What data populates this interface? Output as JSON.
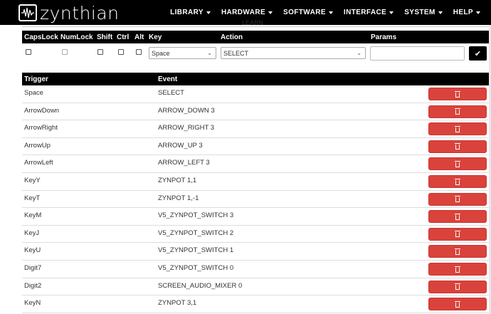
{
  "brand": {
    "name": "zynthian"
  },
  "nav": [
    {
      "label": "LIBRARY"
    },
    {
      "label": "HARDWARE"
    },
    {
      "label": "SOFTWARE"
    },
    {
      "label": "INTERFACE"
    },
    {
      "label": "SYSTEM"
    },
    {
      "label": "HELP"
    }
  ],
  "section_title": "LEARN",
  "form": {
    "headers": {
      "capslock": "CapsLock",
      "numlock": "NumLock",
      "shift": "Shift",
      "ctrl": "Ctrl",
      "alt": "Alt",
      "key": "Key",
      "action": "Action",
      "params": "Params"
    },
    "key_value": "Space",
    "action_value": "SELECT",
    "params_value": ""
  },
  "table": {
    "headers": {
      "trigger": "Trigger",
      "event": "Event"
    },
    "rows": [
      {
        "trigger": "Space",
        "event": "SELECT"
      },
      {
        "trigger": "ArrowDown",
        "event": "ARROW_DOWN 3"
      },
      {
        "trigger": "ArrowRight",
        "event": "ARROW_RIGHT 3"
      },
      {
        "trigger": "ArrowUp",
        "event": "ARROW_UP 3"
      },
      {
        "trigger": "ArrowLeft",
        "event": "ARROW_LEFT 3"
      },
      {
        "trigger": "KeyY",
        "event": "ZYNPOT 1,1"
      },
      {
        "trigger": "KeyT",
        "event": "ZYNPOT 1,-1"
      },
      {
        "trigger": "KeyM",
        "event": "V5_ZYNPOT_SWITCH 3"
      },
      {
        "trigger": "KeyJ",
        "event": "V5_ZYNPOT_SWITCH 2"
      },
      {
        "trigger": "KeyU",
        "event": "V5_ZYNPOT_SWITCH 1"
      },
      {
        "trigger": "Digit7",
        "event": "V5_ZYNPOT_SWITCH 0"
      },
      {
        "trigger": "Digit2",
        "event": "SCREEN_AUDIO_MIXER 0"
      },
      {
        "trigger": "KeyN",
        "event": "ZYNPOT 3,1"
      }
    ]
  },
  "colors": {
    "navbar": "#000000",
    "delete_button": "#d9433b"
  },
  "icons": {
    "delete": "trash-icon",
    "submit": "check-icon"
  }
}
